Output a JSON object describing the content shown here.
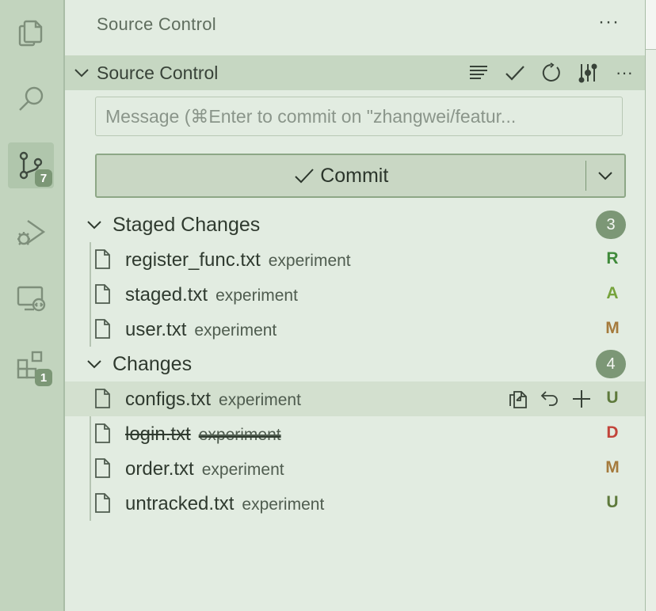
{
  "activity_bar": {
    "items": [
      {
        "name": "explorer",
        "icon": "files-icon"
      },
      {
        "name": "search",
        "icon": "search-icon"
      },
      {
        "name": "source-control",
        "icon": "source-control-icon",
        "badge": "7",
        "active": true
      },
      {
        "name": "run-debug",
        "icon": "run-debug-icon"
      },
      {
        "name": "remote-explorer",
        "icon": "remote-explorer-icon"
      },
      {
        "name": "extensions",
        "icon": "extensions-icon",
        "badge": "1"
      }
    ]
  },
  "view": {
    "title": "Source Control",
    "more_label": "···"
  },
  "section": {
    "title": "Source Control",
    "actions": [
      "view-as-tree-icon",
      "commit-check-icon",
      "refresh-icon",
      "graph-icon",
      "more-icon"
    ],
    "more_label": "···"
  },
  "commit": {
    "message_placeholder": "Message (⌘Enter to commit on \"zhangwei/featur...",
    "message_value": "",
    "button_label": "Commit"
  },
  "groups": [
    {
      "title": "Staged Changes",
      "count": "3",
      "files": [
        {
          "name": "register_func.txt",
          "dir": "experiment",
          "status": "R",
          "status_color": "#3f8a3a"
        },
        {
          "name": "staged.txt",
          "dir": "experiment",
          "status": "A",
          "status_color": "#76a33c"
        },
        {
          "name": "user.txt",
          "dir": "experiment",
          "status": "M",
          "status_color": "#a57a3c"
        }
      ]
    },
    {
      "title": "Changes",
      "count": "4",
      "files": [
        {
          "name": "configs.txt",
          "dir": "experiment",
          "status": "U",
          "status_color": "#5e7a3c"
        },
        {
          "name": "login.txt",
          "dir": "experiment",
          "status": "D",
          "status_color": "#c2443a"
        },
        {
          "name": "order.txt",
          "dir": "experiment",
          "status": "M",
          "status_color": "#a57a3c"
        },
        {
          "name": "untracked.txt",
          "dir": "experiment",
          "status": "U",
          "status_color": "#5e7a3c"
        }
      ]
    }
  ],
  "colors": {
    "activity_bar_bg": "#c2d4be",
    "sidebar_bg": "#e2ece1",
    "section_header_bg": "#c6d7c2",
    "badge_bg": "#7c9776",
    "hover_row_bg": "#d3e0cf"
  }
}
